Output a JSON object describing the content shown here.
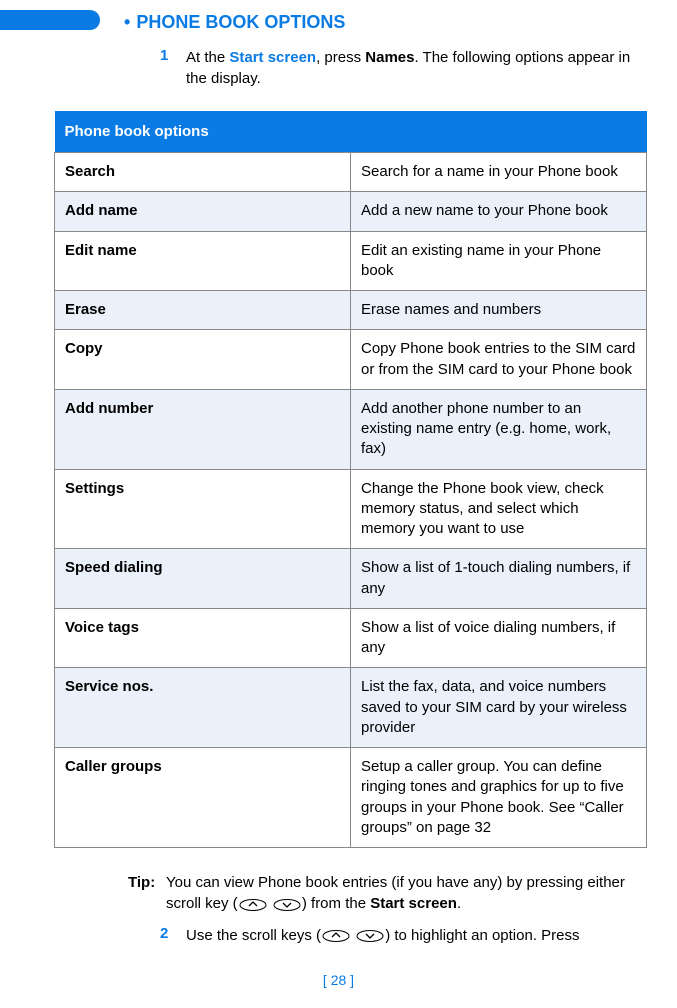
{
  "heading": "PHONE BOOK OPTIONS",
  "step1": {
    "num": "1",
    "pre": "At the ",
    "start_screen": "Start screen",
    "mid": ", press ",
    "names": "Names",
    "post": ". The following options appear in the display."
  },
  "table": {
    "title": "Phone book options",
    "rows": [
      {
        "name": "Search",
        "desc": "Search for a name in your Phone book"
      },
      {
        "name": "Add name",
        "desc": "Add a new name to your Phone book"
      },
      {
        "name": "Edit name",
        "desc": "Edit an existing name in your Phone book"
      },
      {
        "name": "Erase",
        "desc": "Erase names and numbers"
      },
      {
        "name": "Copy",
        "desc": "Copy Phone book entries to the SIM card or from the SIM card to your Phone book"
      },
      {
        "name": "Add number",
        "desc": "Add another phone number to an existing name entry (e.g. home, work, fax)"
      },
      {
        "name": "Settings",
        "desc": "Change the Phone book view, check memory status, and select which memory you want to use"
      },
      {
        "name": "Speed dialing",
        "desc": "Show a list of 1-touch dialing numbers, if any"
      },
      {
        "name": "Voice tags",
        "desc": "Show a list of voice dialing numbers, if any"
      },
      {
        "name": "Service nos.",
        "desc": "List the fax, data, and voice numbers saved to your SIM card by your wireless provider"
      },
      {
        "name": "Caller groups",
        "desc": "Setup a caller group. You can define ringing tones and graphics for up to five groups in your Phone book. See “Caller groups” on page 32"
      }
    ]
  },
  "tip": {
    "label": "Tip:",
    "pre": "You can view Phone book entries (if you have any) by pressing either scroll key (",
    "post": ") from the ",
    "start_screen": "Start screen",
    "end": "."
  },
  "step2": {
    "num": "2",
    "pre": "Use the scroll keys (",
    "post": ") to highlight an option. Press"
  },
  "page_number": "[ 28 ]"
}
